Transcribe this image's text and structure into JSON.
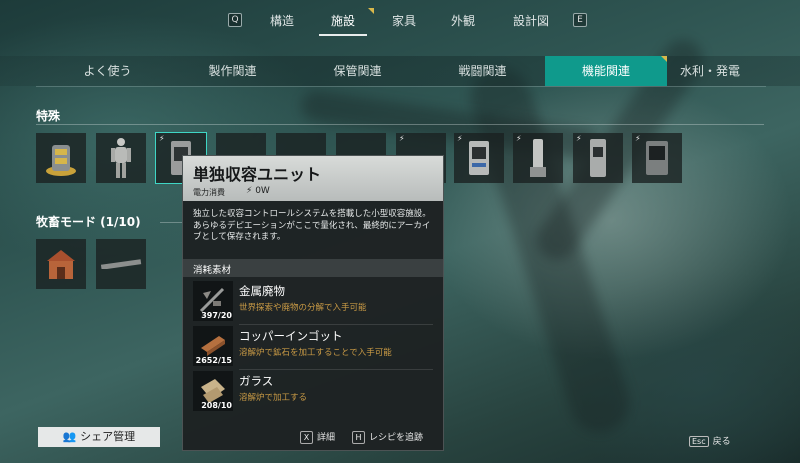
{
  "top_nav": {
    "key_left": "Q",
    "key_right": "E",
    "items": [
      "構造",
      "施設",
      "家具",
      "外観",
      "設計図"
    ],
    "active": "施設"
  },
  "category_tabs": {
    "items": [
      "よく使う",
      "製作関連",
      "保管関連",
      "戦闘関連",
      "機能関連",
      "水利・発電"
    ],
    "active": "機能関連"
  },
  "sections": {
    "special": "特殊",
    "ranch": "牧畜モード (1/10)"
  },
  "tooltip": {
    "title": "単独収容ユニット",
    "power_label": "電力消費",
    "power_value": "0W",
    "description": "独立した収容コントロールシステムを搭載した小型収容施設。あらゆるデピエーションがここで量化され、最終的にアーカイブとして保存されます。",
    "materials_label": "消耗素材",
    "materials": [
      {
        "name": "金属廃物",
        "source": "世界探索や廃物の分解で入手可能",
        "count": "397/20"
      },
      {
        "name": "コッパーインゴット",
        "source": "溶解炉で鉱石を加工することで入手可能",
        "count": "2652/15"
      },
      {
        "name": "ガラス",
        "source": "溶解炉で加工する",
        "count": "208/10"
      }
    ],
    "footer": {
      "detail_key": "X",
      "detail_label": "詳細",
      "track_key": "H",
      "track_label": "レシピを追跡"
    }
  },
  "share_button": "シェア管理",
  "esc": {
    "key": "Esc",
    "label": "戻る"
  },
  "colors": {
    "accent_tab": "#0f9a8c",
    "select_outline": "#3fd6c5",
    "material_source": "#c99a45"
  }
}
